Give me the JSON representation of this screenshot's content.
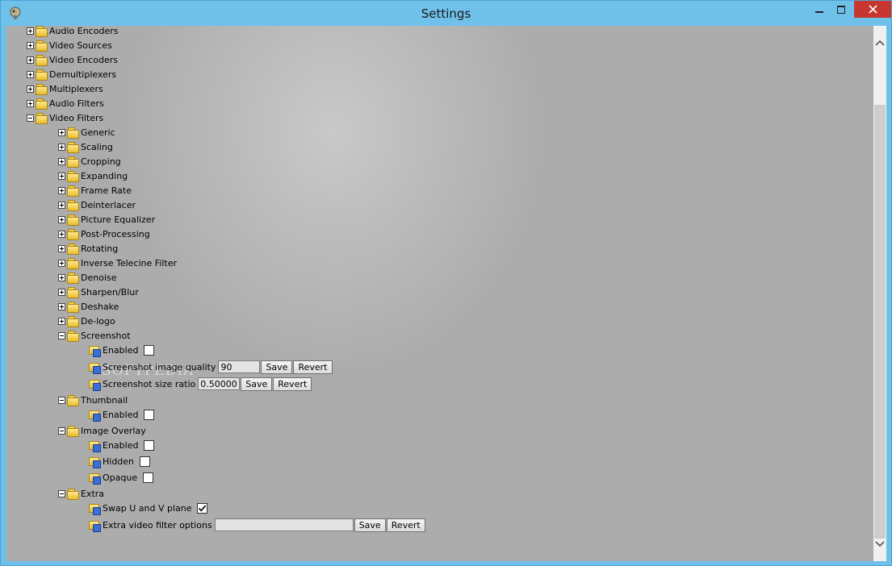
{
  "window": {
    "title": "Settings"
  },
  "watermark": "SOFTPEDIA",
  "tree": {
    "audio_encoders": "Audio Encoders",
    "video_sources": "Video Sources",
    "video_encoders": "Video Encoders",
    "demultiplexers": "Demultiplexers",
    "multiplexers": "Multiplexers",
    "audio_filters": "Audio Filters",
    "video_filters": "Video Filters",
    "generic": "Generic",
    "scaling": "Scaling",
    "cropping": "Cropping",
    "expanding": "Expanding",
    "frame_rate": "Frame Rate",
    "deinterlacer": "Deinterlacer",
    "picture_equalizer": "Picture Equalizer",
    "post_processing": "Post-Processing",
    "rotating": "Rotating",
    "inverse_telecine": "Inverse Telecine Filter",
    "denoise": "Denoise",
    "sharpen_blur": "Sharpen/Blur",
    "deshake": "Deshake",
    "de_logo": "De-logo",
    "screenshot": {
      "label": "Screenshot",
      "enabled_label": "Enabled",
      "enabled_checked": false,
      "quality_label": "Screenshot image quality",
      "quality_value": "90",
      "size_ratio_label": "Screenshot size ratio",
      "size_ratio_value": "0.500000"
    },
    "thumbnail": {
      "label": "Thumbnail",
      "enabled_label": "Enabled",
      "enabled_checked": false
    },
    "image_overlay": {
      "label": "Image Overlay",
      "enabled_label": "Enabled",
      "hidden_label": "Hidden",
      "opaque_label": "Opaque"
    },
    "extra": {
      "label": "Extra",
      "swap_uv_label": "Swap U and V plane",
      "swap_uv_checked": true,
      "options_label": "Extra video filter options",
      "options_value": ""
    }
  },
  "buttons": {
    "save": "Save",
    "revert": "Revert"
  },
  "icons": {
    "app": "app-icon",
    "folder": "folder-icon",
    "setting": "setting-icon",
    "expander_plus": "plus-box-icon",
    "expander_minus": "minus-box-icon"
  }
}
